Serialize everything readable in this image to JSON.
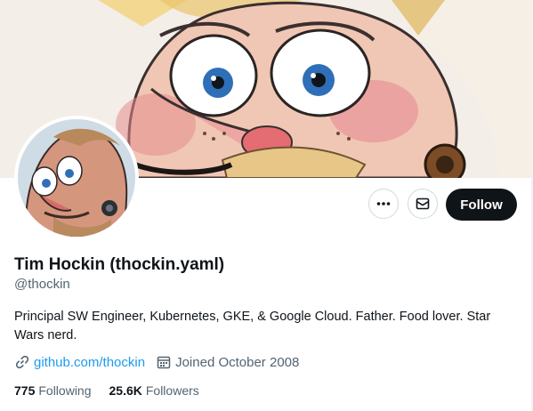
{
  "profile": {
    "name": "Tim Hockin (thockin.yaml)",
    "handle": "@thockin",
    "bio": "Principal SW Engineer, Kubernetes, GKE, & Google Cloud.  Father.  Food lover.  Star Wars nerd.",
    "website": "github.com/thockin",
    "joined": "Joined October 2008"
  },
  "stats": {
    "following_count": "775",
    "following_label": "Following",
    "followers_count": "25.6K",
    "followers_label": "Followers"
  },
  "actions": {
    "follow_label": "Follow",
    "more_icon": "more-horizontal-icon",
    "message_icon": "envelope-icon"
  },
  "colors": {
    "accent": "#1d9bf0",
    "follow_bg": "#0f1419",
    "secondary_text": "#536471"
  }
}
